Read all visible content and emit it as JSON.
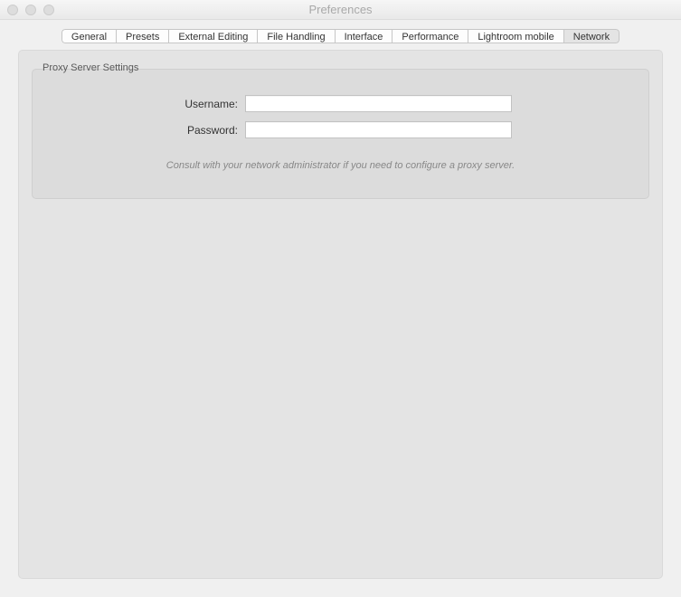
{
  "window": {
    "title": "Preferences"
  },
  "tabs": [
    {
      "label": "General"
    },
    {
      "label": "Presets"
    },
    {
      "label": "External Editing"
    },
    {
      "label": "File Handling"
    },
    {
      "label": "Interface"
    },
    {
      "label": "Performance"
    },
    {
      "label": "Lightroom mobile"
    },
    {
      "label": "Network"
    }
  ],
  "section": {
    "title": "Proxy Server Settings",
    "usernameLabel": "Username:",
    "passwordLabel": "Password:",
    "usernameValue": "",
    "passwordValue": "",
    "hint": "Consult with your network administrator if you need to configure a proxy server."
  }
}
